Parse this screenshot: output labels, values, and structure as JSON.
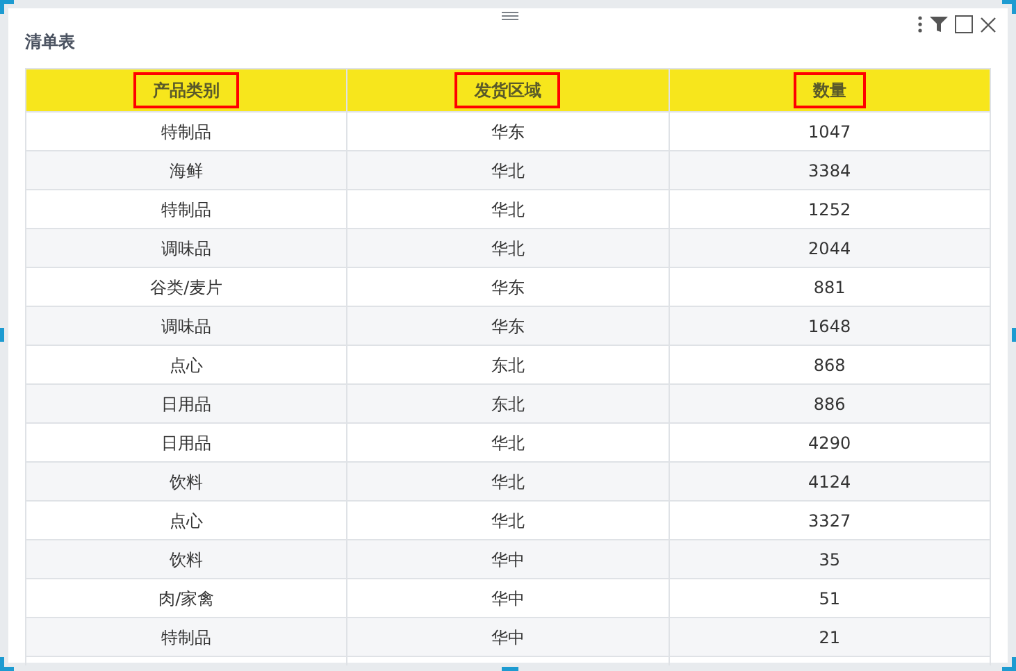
{
  "panel": {
    "title": "清单表",
    "toolbar": [
      {
        "kind": "more"
      },
      {
        "kind": "filter"
      },
      {
        "kind": "maximize"
      },
      {
        "kind": "close"
      }
    ]
  },
  "table": {
    "columns": [
      {
        "label": "产品类别",
        "highlighted": true
      },
      {
        "label": "发货区域",
        "highlighted": true
      },
      {
        "label": "数量",
        "highlighted": true
      }
    ],
    "rows": [
      [
        "特制品",
        "华东",
        "1047"
      ],
      [
        "海鲜",
        "华北",
        "3384"
      ],
      [
        "特制品",
        "华北",
        "1252"
      ],
      [
        "调味品",
        "华北",
        "2044"
      ],
      [
        "谷类/麦片",
        "华东",
        "881"
      ],
      [
        "调味品",
        "华东",
        "1648"
      ],
      [
        "点心",
        "东北",
        "868"
      ],
      [
        "日用品",
        "东北",
        "886"
      ],
      [
        "日用品",
        "华北",
        "4290"
      ],
      [
        "饮料",
        "华北",
        "4124"
      ],
      [
        "点心",
        "华北",
        "3327"
      ],
      [
        "饮料",
        "华中",
        "35"
      ],
      [
        "肉/家禽",
        "华中",
        "51"
      ],
      [
        "特制品",
        "华中",
        "21"
      ]
    ]
  }
}
